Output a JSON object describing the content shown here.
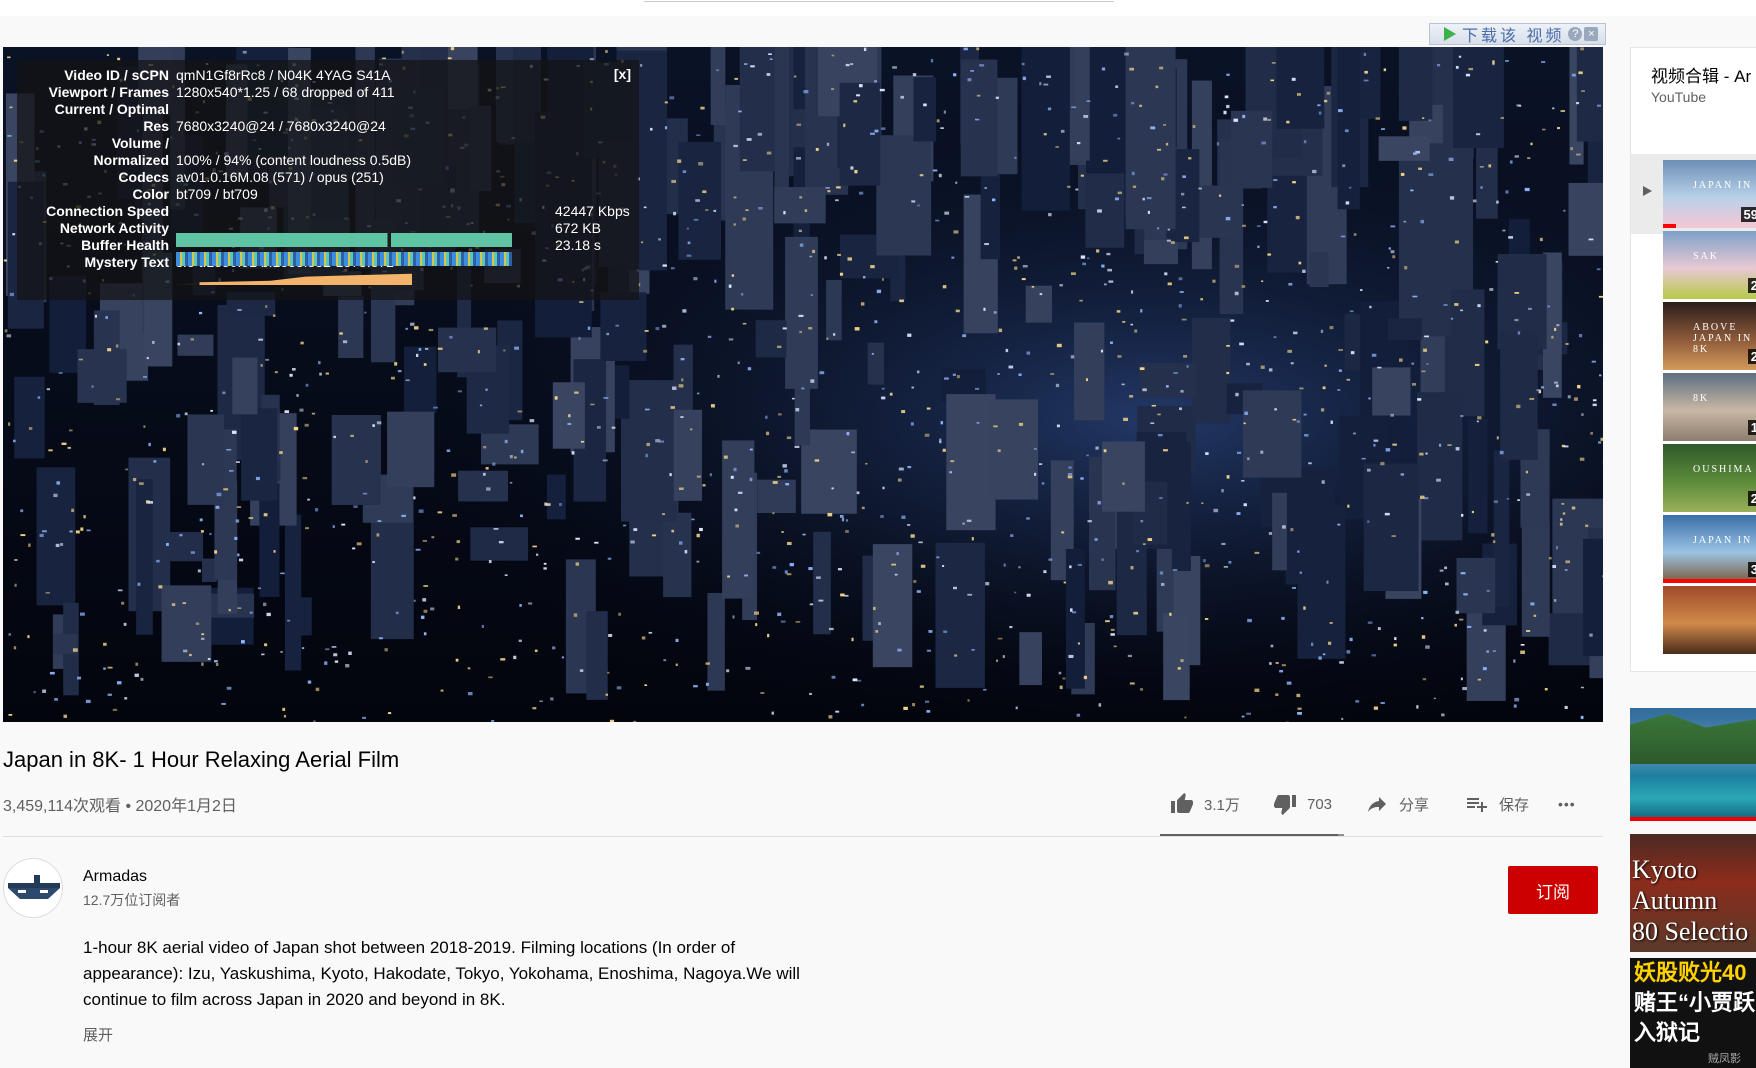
{
  "download_bar": {
    "label": "下载该 视频",
    "help": "?",
    "close": "×"
  },
  "stats": {
    "close": "[x]",
    "rows": [
      {
        "k": "Video ID / sCPN",
        "v": "qmN1Gf8rRc8 / N04K 4YAG S41A"
      },
      {
        "k": "Viewport / Frames",
        "v": "1280x540*1.25 / 68 dropped of 411"
      },
      {
        "k": "Current / Optimal",
        "v": ""
      },
      {
        "k": "Res",
        "v": "7680x3240@24 / 7680x3240@24"
      },
      {
        "k": "Volume /",
        "v": ""
      },
      {
        "k": "Normalized",
        "v": "100% / 94% (content loudness 0.5dB)"
      },
      {
        "k": "Codecs",
        "v": "av01.0.16M.08 (571) / opus (251)"
      },
      {
        "k": "Color",
        "v": "bt709 / bt709"
      },
      {
        "k": "Connection Speed",
        "v": "42447 Kbps"
      },
      {
        "k": "Network Activity",
        "v": "672 KB"
      },
      {
        "k": "Buffer Health",
        "v": "23.18 s"
      },
      {
        "k": "Mystery Text",
        "v": "s:8 t:1850.91 b:1833.832-1873.872"
      }
    ]
  },
  "video": {
    "title": "Japan in 8K- 1 Hour Relaxing Aerial Film",
    "meta": "3,459,114次观看 • 2020年1月2日",
    "likes": "3.1万",
    "dislikes": "703",
    "like_ratio": 0.97,
    "share": "分享",
    "save": "保存",
    "more": "•••"
  },
  "channel": {
    "name": "Armadas",
    "subscribers": "12.7万位订阅者",
    "subscribe": "订阅"
  },
  "description": {
    "text": "1-hour 8K aerial video of Japan shot between 2018-2019. Filming locations (In order of appearance): Izu, Yaskushima, Kyoto, Hakodate, Tokyo, Yokohama, Enoshima, Nagoya.We will continue to film across Japan in 2020 and beyond in 8K.",
    "expand": "展开"
  },
  "playlist": {
    "title": "视频合辑 - Ar",
    "owner": "YouTube",
    "items": [
      {
        "label": "JAPAN IN",
        "duration": "59"
      },
      {
        "label": "SAK",
        "duration": "2"
      },
      {
        "label": "ABOVE JAPAN IN 8K",
        "duration": "2"
      },
      {
        "label": "8K",
        "duration": "1"
      },
      {
        "label": "OUSHIMA",
        "duration": "2"
      },
      {
        "label": "JAPAN IN",
        "duration": "3"
      },
      {
        "label": "",
        "duration": ""
      }
    ]
  },
  "side": {
    "kyoto": [
      "Kyoto",
      "Autumn",
      "80 Selectio"
    ],
    "ad": [
      "妖股败光40",
      "赌王“小贾跃",
      "入狱记"
    ],
    "ad_small": "贼凤影"
  }
}
